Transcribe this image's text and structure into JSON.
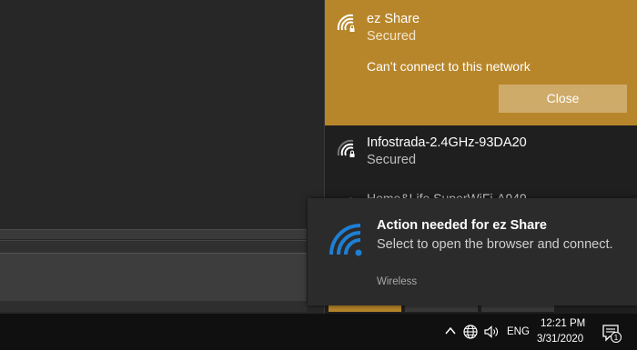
{
  "wifi_flyout": {
    "selected_network": {
      "name": "ez Share",
      "status": "Secured",
      "error": "Can’t connect to this network",
      "close_label": "Close"
    },
    "networks": [
      {
        "name": "Infostrada-2.4GHz-93DA20",
        "status": "Secured"
      }
    ],
    "partial_network_name": "Home&Life SuperWiFi-A949"
  },
  "toast": {
    "title": "Action needed for ez Share",
    "body": "Select to open the browser and connect.",
    "app_name": "Wireless",
    "icon": "wifi-icon"
  },
  "taskbar": {
    "language": "ENG",
    "time": "12:21 PM",
    "date": "3/31/2020",
    "notification_count": "1"
  },
  "colors": {
    "accent": "#b8862a",
    "toast_icon": "#1e7fd4",
    "background": "#272727"
  }
}
